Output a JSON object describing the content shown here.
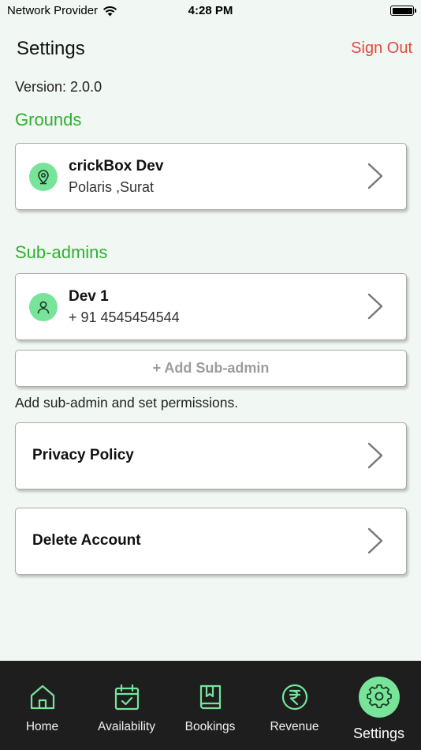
{
  "status_bar": {
    "carrier": "Network Provider",
    "time": "4:28 PM"
  },
  "header": {
    "title": "Settings",
    "sign_out": "Sign Out"
  },
  "version": "Version: 2.0.0",
  "grounds": {
    "title": "Grounds",
    "items": [
      {
        "name": "crickBox Dev",
        "location": "Polaris  ,Surat"
      }
    ]
  },
  "sub_admins": {
    "title": "Sub-admins",
    "items": [
      {
        "name": "Dev 1",
        "phone": "+ 91 4545454544"
      }
    ],
    "add_button": "+ Add Sub-admin",
    "helper_text": "Add sub-admin and set permissions."
  },
  "links": {
    "privacy_policy": "Privacy Policy",
    "delete_account": "Delete Account"
  },
  "tab_bar": {
    "tabs": [
      {
        "label": "Home",
        "icon": "home-icon"
      },
      {
        "label": "Availability",
        "icon": "calendar-check-icon"
      },
      {
        "label": "Bookings",
        "icon": "bookmark-book-icon"
      },
      {
        "label": "Revenue",
        "icon": "rupee-icon"
      },
      {
        "label": "Settings",
        "icon": "gear-icon"
      }
    ],
    "active": "Settings"
  },
  "colors": {
    "accent_green": "#2fb02f",
    "icon_green": "#78e49a",
    "sign_out_red": "#e8463d",
    "tab_bar_bg": "#1e1e1e",
    "page_bg": "#f1f7f2"
  }
}
